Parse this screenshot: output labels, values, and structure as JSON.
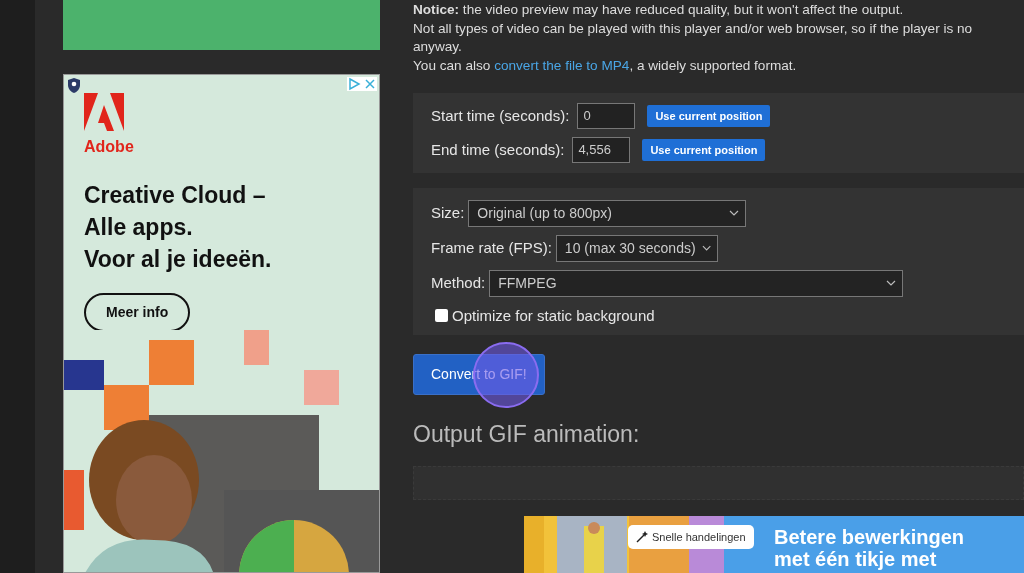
{
  "side_ad": {
    "brand": "Adobe",
    "headline": [
      "Creative Cloud –",
      "Alle apps.",
      "Voor al je ideeën."
    ],
    "button": "Meer info"
  },
  "notice": {
    "text": "**Notice:** the video preview may have reduced quality, but it won't affect the output."
  },
  "info_lines": [
    "Not all types of video can be played with this player and/or web browser, so if the player is no",
    "anyway."
  ],
  "mp4_line": {
    "before": "You can also ",
    "link": "convert the file to MP4",
    "after": ", a widely supported format."
  },
  "time_fields": [
    {
      "label": "Start time (seconds):",
      "value": "0",
      "button": "Use current position"
    },
    {
      "label": "End time (seconds):",
      "value": "4,556",
      "button": "Use current position"
    }
  ],
  "options": [
    {
      "label": "Size:",
      "value": "Original (up to 800px)"
    },
    {
      "label": "Frame rate (FPS):",
      "value": "10 (max 30 seconds)"
    },
    {
      "label": "Method:",
      "value": "FFMPEG"
    }
  ],
  "static_background": {
    "label": "Optimize for static background",
    "checked": false
  },
  "convert_button": "Convert to GIF!",
  "output_heading": "Output GIF animation:",
  "bottom_ad": {
    "chip": "Snelle handelingen",
    "headline": [
      "Betere bewerkingen",
      "met één tikje met"
    ]
  }
}
